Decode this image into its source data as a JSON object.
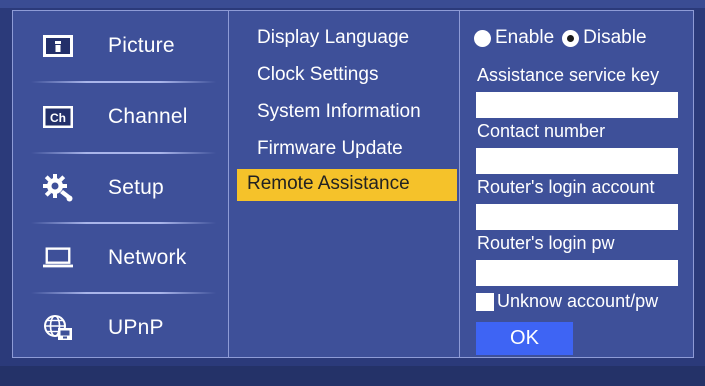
{
  "nav": {
    "items": [
      {
        "label": "Picture",
        "icon": "picture-icon"
      },
      {
        "label": "Channel",
        "icon": "channel-icon",
        "icon_text": "Ch"
      },
      {
        "label": "Setup",
        "icon": "gear-wrench-icon"
      },
      {
        "label": "Network",
        "icon": "laptop-icon"
      },
      {
        "label": "UPnP",
        "icon": "globe-network-icon"
      }
    ]
  },
  "submenu": {
    "items": [
      {
        "label": "Display Language"
      },
      {
        "label": "Clock Settings"
      },
      {
        "label": "System Information"
      },
      {
        "label": "Firmware Update"
      },
      {
        "label": "Remote Assistance",
        "active": true
      }
    ]
  },
  "remote": {
    "enable_label": "Enable",
    "disable_label": "Disable",
    "selected": "Disable",
    "key_label": "Assistance service key",
    "key_value": "",
    "contact_label": "Contact number",
    "contact_value": "",
    "router_account_label": "Router's login account",
    "router_account_value": "",
    "router_pw_label": "Router's login pw",
    "router_pw_value": "",
    "unknown_label": "Unknow account/pw",
    "unknown_checked": false,
    "ok_label": "OK"
  },
  "colors": {
    "background": "#2b3a7a",
    "panel": "#3e5099",
    "highlight": "#f5c22a",
    "ok_button": "#3e64f4"
  }
}
